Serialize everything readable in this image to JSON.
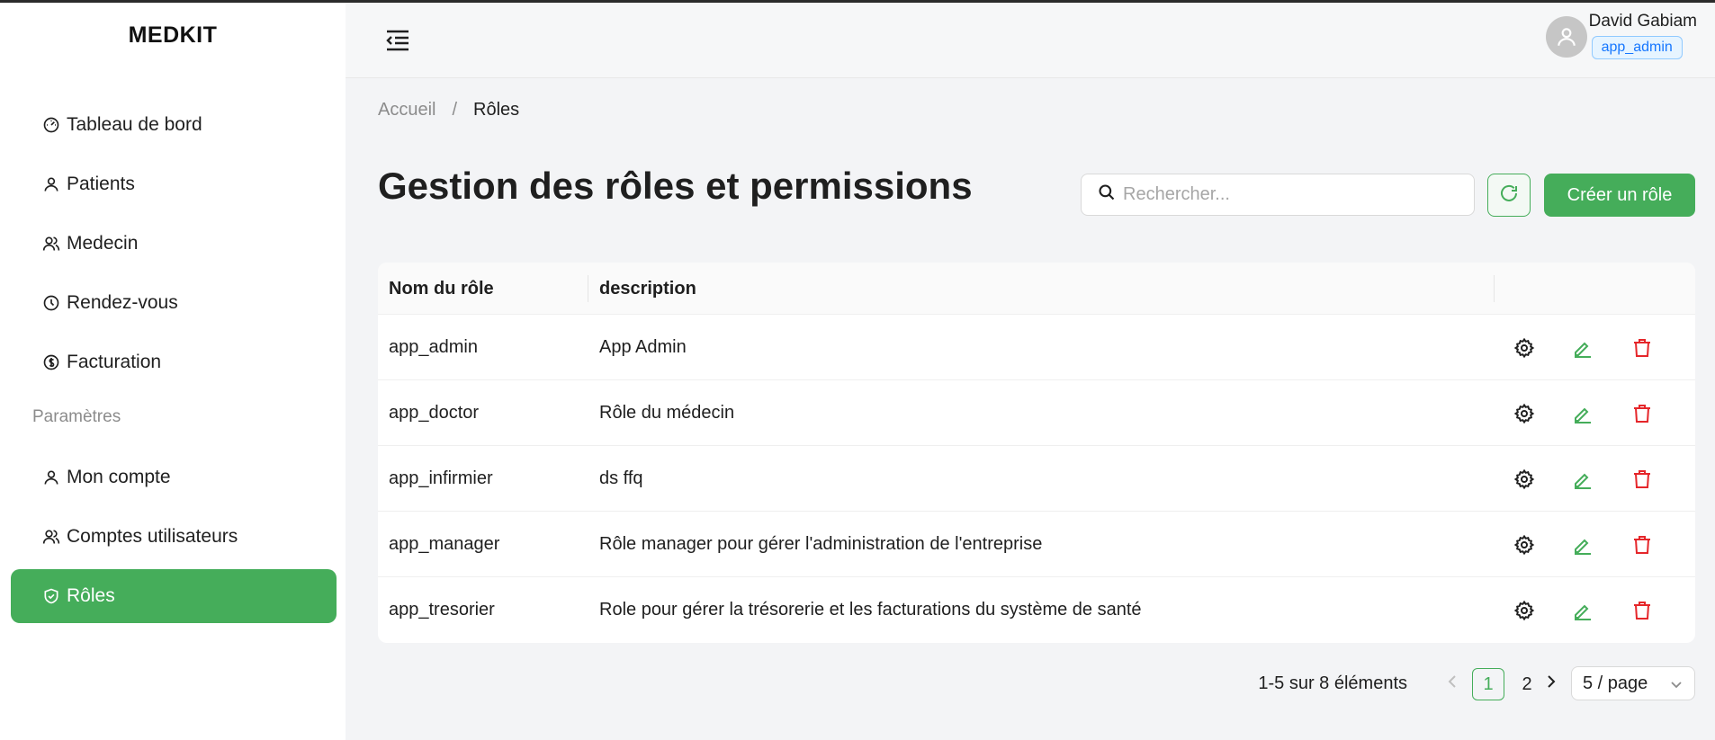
{
  "app": {
    "brand": "MEDKIT"
  },
  "sidebar": {
    "items": [
      {
        "label": "Tableau de bord",
        "icon": "dashboard-icon"
      },
      {
        "label": "Patients",
        "icon": "user-icon"
      },
      {
        "label": "Medecin",
        "icon": "users-icon"
      },
      {
        "label": "Rendez-vous",
        "icon": "clock-icon"
      },
      {
        "label": "Facturation",
        "icon": "dollar-icon"
      }
    ],
    "group_label": "Paramètres",
    "settings_items": [
      {
        "label": "Mon compte",
        "icon": "user-icon"
      },
      {
        "label": "Comptes utilisateurs",
        "icon": "users-icon"
      },
      {
        "label": "Rôles",
        "icon": "shield-icon",
        "active": true
      }
    ]
  },
  "header": {
    "user_name": "David Gabiam",
    "user_role": "app_admin"
  },
  "breadcrumb": {
    "home": "Accueil",
    "separator": "/",
    "current": "Rôles"
  },
  "main": {
    "title": "Gestion des rôles et permissions",
    "search_placeholder": "Rechercher...",
    "create_label": "Créer un rôle"
  },
  "table": {
    "columns": [
      "Nom du rôle",
      "description"
    ],
    "rows": [
      {
        "name": "app_admin",
        "description": "App Admin"
      },
      {
        "name": "app_doctor",
        "description": "Rôle du médecin"
      },
      {
        "name": "app_infirmier",
        "description": "ds ffq"
      },
      {
        "name": "app_manager",
        "description": "Rôle manager pour gérer l'administration de l'entreprise"
      },
      {
        "name": "app_tresorier",
        "description": "Role pour gérer la trésorerie et les facturations du système de santé"
      }
    ]
  },
  "pagination": {
    "total_text": "1-5 sur 8 éléments",
    "pages": [
      "1",
      "2"
    ],
    "current_page": "1",
    "page_size": "5 / page"
  },
  "colors": {
    "accent": "#45ad5a",
    "danger": "#e5262a",
    "badge": "#1677ff"
  }
}
